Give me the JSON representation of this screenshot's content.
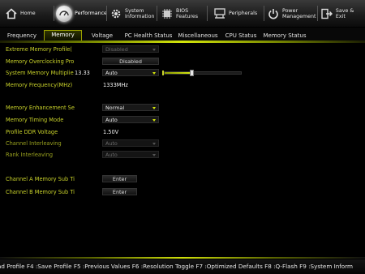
{
  "top_menu": [
    {
      "label": "Home",
      "icon": "home-icon"
    },
    {
      "label": "Performance",
      "icon": "speedometer-icon",
      "active": true
    },
    {
      "label": "System\nInformation",
      "icon": "gear-icon"
    },
    {
      "label": "BIOS\nFeatures",
      "icon": "chip-icon"
    },
    {
      "label": "Peripherals",
      "icon": "peripherals-icon"
    },
    {
      "label": "Power\nManagement",
      "icon": "power-icon"
    },
    {
      "label": "Save & Exit",
      "icon": "exit-icon"
    }
  ],
  "tabs": [
    {
      "label": "Frequency"
    },
    {
      "label": "Memory",
      "active": true
    },
    {
      "label": "Voltage"
    },
    {
      "label": "PC Health Status"
    },
    {
      "label": "Miscellaneous"
    },
    {
      "label": "CPU Status"
    },
    {
      "label": "Memory Status"
    }
  ],
  "settings": {
    "extreme_memory_profile": {
      "label": "Extreme Memory Profile(",
      "value": "Disabled"
    },
    "memory_overclocking": {
      "label": "Memory Overclocking Pro",
      "value": "Disabled"
    },
    "system_memory_multiplier": {
      "label": "System Memory Multiplie",
      "current": "13.33",
      "value": "Auto",
      "slider_level": 0.35
    },
    "memory_frequency": {
      "label": "Memory Frequency(MHz)",
      "value": "1333MHz"
    },
    "memory_enhancement": {
      "label": "Memory Enhancement Se",
      "value": "Normal"
    },
    "memory_timing_mode": {
      "label": "Memory Timing Mode",
      "value": "Auto"
    },
    "profile_ddr_voltage": {
      "label": "Profile DDR Voltage",
      "value": "1.50V"
    },
    "channel_interleaving": {
      "label": "Channel Interleaving",
      "value": "Auto"
    },
    "rank_interleaving": {
      "label": "Rank Interleaving",
      "value": "Auto"
    },
    "channel_a_sub_timings": {
      "label": "Channel A Memory Sub Ti",
      "value": "Enter"
    },
    "channel_b_sub_timings": {
      "label": "Channel B Memory Sub Ti",
      "value": "Enter"
    }
  },
  "hotkey_bar": "ad Profile F4 :Save Profile F5 :Previous Values F6 :Resolution Toggle F7 :Optimized Defaults F8 :Q-Flash F9 :System Inform",
  "colors": {
    "accent": "#c9d22a",
    "glow": "#d4e60a",
    "background": "#000000"
  }
}
